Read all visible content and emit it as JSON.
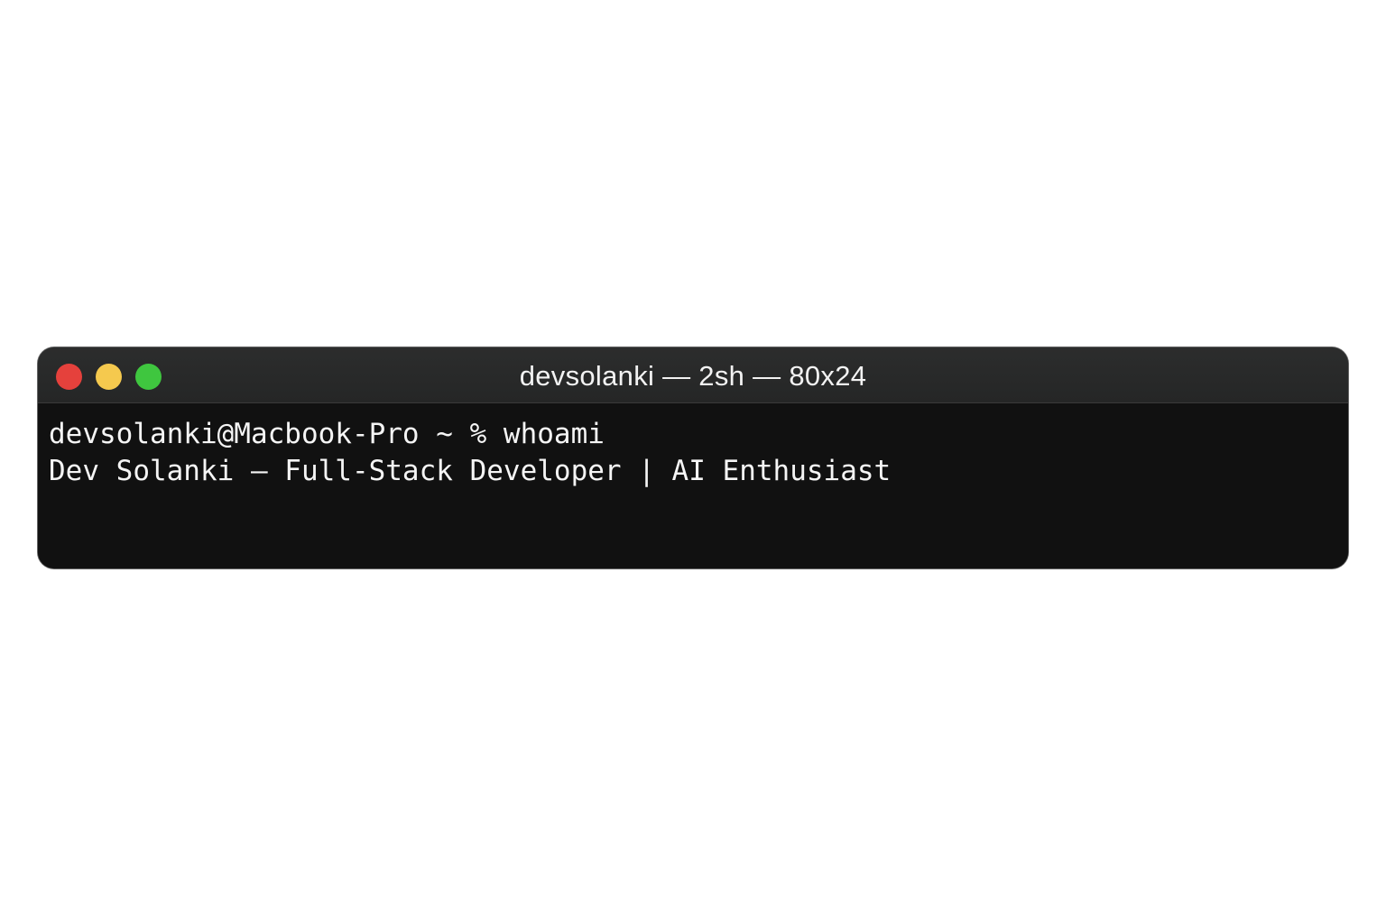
{
  "window": {
    "title": "devsolanki — 2sh — 80x24"
  },
  "controls": {
    "close_icon": "close-window-icon",
    "minimize_icon": "minimize-window-icon",
    "zoom_icon": "zoom-window-icon"
  },
  "terminal": {
    "prompt": "devsolanki@Macbook-Pro ~ % ",
    "command": "whoami",
    "output": "Dev Solanki — Full-Stack Developer | AI Enthusiast"
  },
  "colors": {
    "close": "#e5413c",
    "minimize": "#f5c94e",
    "zoom": "#3fc63f",
    "background": "#121212"
  }
}
